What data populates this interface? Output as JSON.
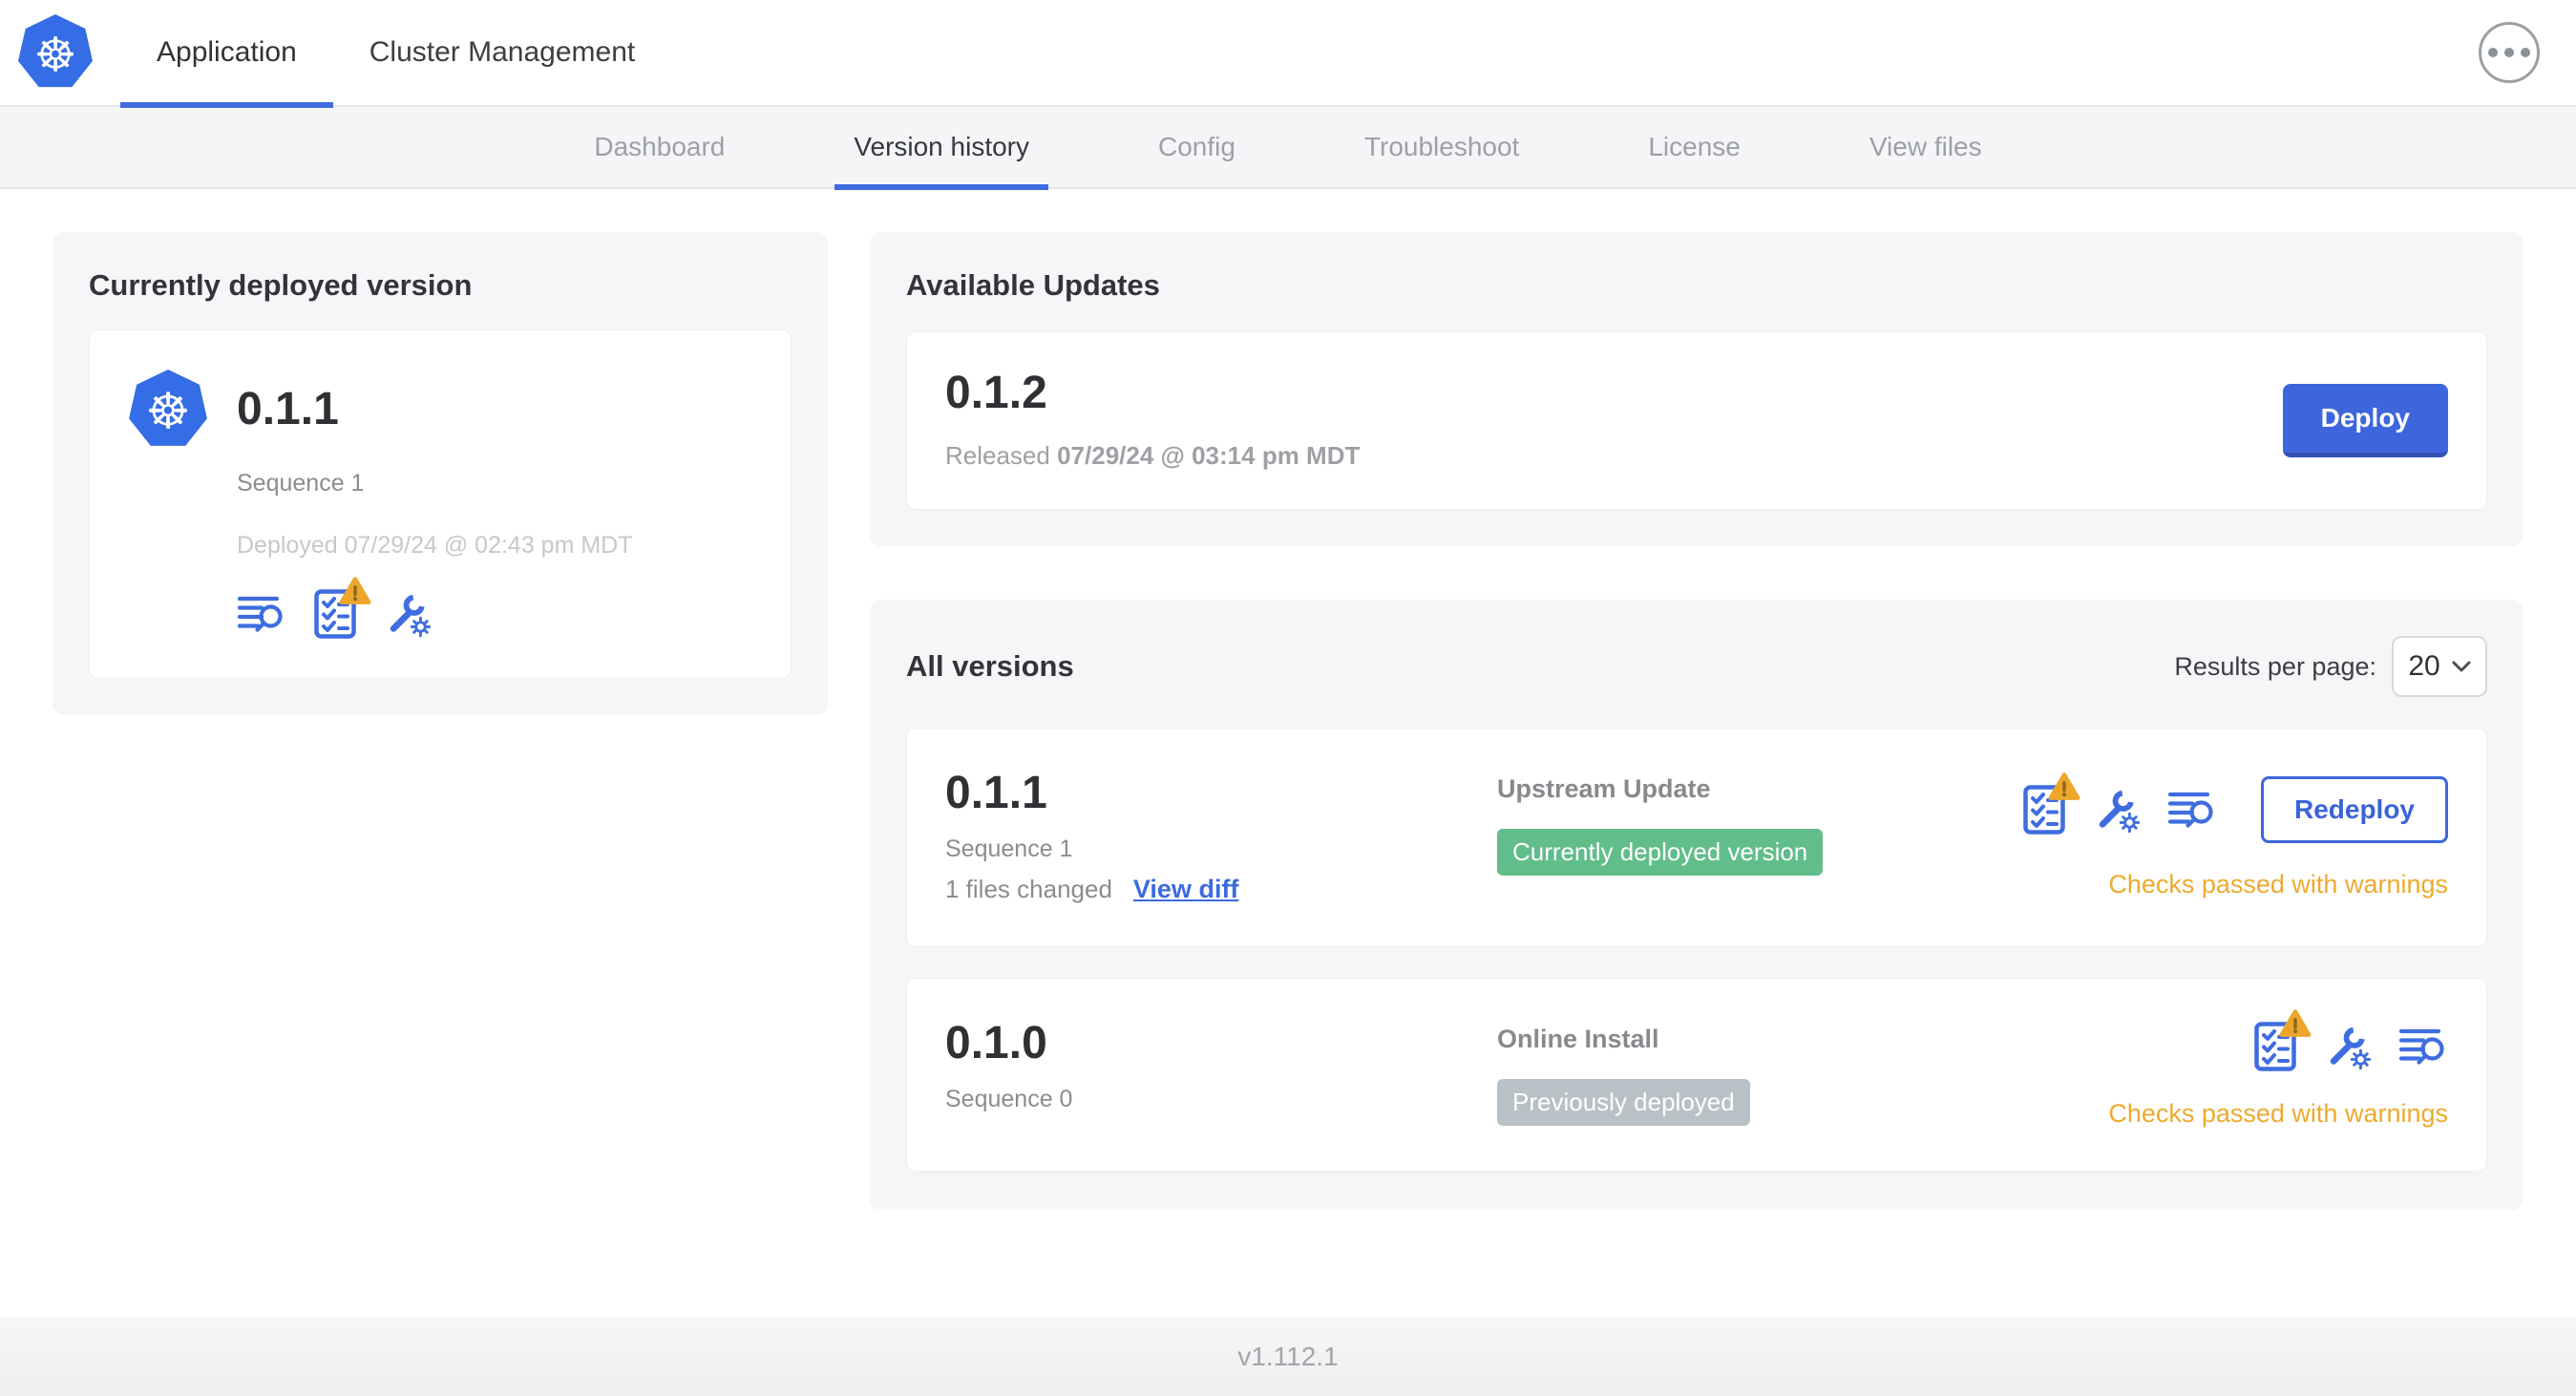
{
  "colors": {
    "accent_blue": "#3d66dd",
    "icon_blue": "#3f6de0",
    "kubernetes_blue": "#346de5",
    "green_badge": "#61bd8a",
    "gray_badge": "#b8c1c5",
    "warning_orange": "#eda62b",
    "status_text_orange": "#edaa2e"
  },
  "header": {
    "tabs": [
      {
        "label": "Application"
      },
      {
        "label": "Cluster Management"
      }
    ]
  },
  "subnav": {
    "tabs": [
      {
        "label": "Dashboard"
      },
      {
        "label": "Version history"
      },
      {
        "label": "Config"
      },
      {
        "label": "Troubleshoot"
      },
      {
        "label": "License"
      },
      {
        "label": "View files"
      }
    ]
  },
  "current": {
    "title": "Currently deployed version",
    "version": "0.1.1",
    "sequence": "Sequence 1",
    "deployed": "Deployed 07/29/24 @ 02:43 pm MDT",
    "icons": [
      "diff-icon",
      "preflight-checks-warning-icon",
      "config-edit-icon"
    ]
  },
  "available": {
    "title": "Available Updates",
    "version": "0.1.2",
    "released_prefix": "Released",
    "released_date": "07/29/24 @ 03:14 pm MDT",
    "deploy_label": "Deploy"
  },
  "all_versions": {
    "title": "All versions",
    "results_per_page_label": "Results per page:",
    "results_per_page_value": "20",
    "rows": [
      {
        "version": "0.1.1",
        "sequence": "Sequence 1",
        "files_changed": "1 files changed",
        "view_diff_label": "View diff",
        "source": "Upstream Update",
        "badge_label": "Currently deployed version",
        "badge_color": "#61bd8a",
        "icons": [
          "preflight-checks-warning-icon",
          "config-edit-icon",
          "diff-icon"
        ],
        "action_label": "Redeploy",
        "status": "Checks passed with warnings"
      },
      {
        "version": "0.1.0",
        "sequence": "Sequence 0",
        "source": "Online Install",
        "badge_label": "Previously deployed",
        "badge_color": "#b8c1c5",
        "icons": [
          "preflight-checks-warning-icon",
          "config-edit-icon",
          "diff-icon"
        ],
        "status": "Checks passed with warnings"
      }
    ]
  },
  "footer": {
    "app_version": "v1.112.1"
  }
}
